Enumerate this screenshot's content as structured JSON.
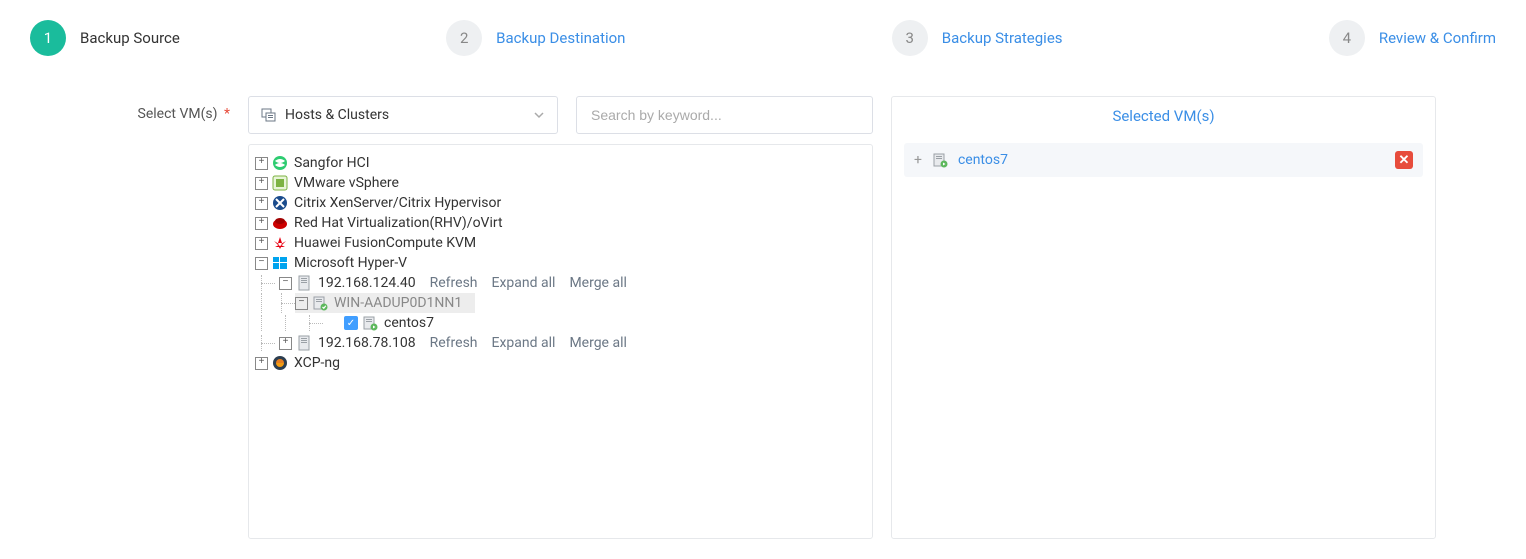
{
  "steps": [
    {
      "num": "1",
      "label": "Backup Source"
    },
    {
      "num": "2",
      "label": "Backup Destination"
    },
    {
      "num": "3",
      "label": "Backup Strategies"
    },
    {
      "num": "4",
      "label": "Review & Confirm"
    }
  ],
  "left_label": "Select VM(s)",
  "view_select": {
    "label": "Hosts & Clusters"
  },
  "search": {
    "placeholder": "Search by keyword..."
  },
  "tree": {
    "roots": [
      {
        "label": "Sangfor HCI",
        "icon": "sangfor"
      },
      {
        "label": "VMware vSphere",
        "icon": "vmware"
      },
      {
        "label": "Citrix XenServer/Citrix Hypervisor",
        "icon": "citrix"
      },
      {
        "label": "Red Hat Virtualization(RHV)/oVirt",
        "icon": "redhat"
      },
      {
        "label": "Huawei FusionCompute KVM",
        "icon": "huawei"
      },
      {
        "label": "Microsoft Hyper-V",
        "icon": "windows"
      },
      {
        "label": "XCP-ng",
        "icon": "xcp"
      }
    ],
    "hyperv_hosts": [
      {
        "ip": "192.168.124.40",
        "actions": {
          "refresh": "Refresh",
          "expand": "Expand all",
          "merge": "Merge all"
        },
        "child_host": {
          "name": "WIN-AADUP0D1NN1"
        },
        "vms": [
          {
            "name": "centos7",
            "checked": true
          }
        ]
      },
      {
        "ip": "192.168.78.108",
        "actions": {
          "refresh": "Refresh",
          "expand": "Expand all",
          "merge": "Merge all"
        }
      }
    ]
  },
  "selected_panel": {
    "title": "Selected VM(s)",
    "items": [
      {
        "name": "centos7"
      }
    ]
  }
}
